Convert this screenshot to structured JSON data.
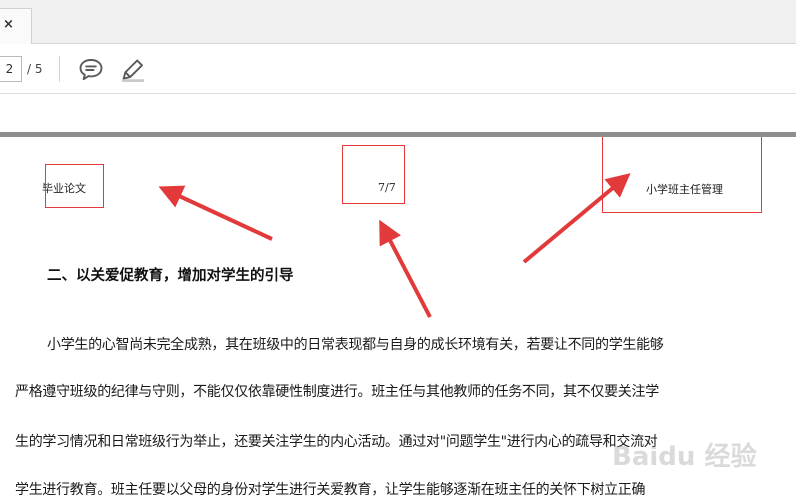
{
  "tabbar": {
    "close_glyph": "×"
  },
  "toolbar": {
    "page_value": "2",
    "page_total": "/ 5",
    "comment_icon": "speech-bubble",
    "pen_icon": "highlighter-pen"
  },
  "page": {
    "header_left": "毕业论文",
    "header_center": "7/7",
    "header_right": "小学班主任管理",
    "heading": "二、以关爱促教育，增加对学生的引导",
    "lines": [
      "小学生的心智尚未完全成熟，其在班级中的日常表现都与自身的成长环境有关，若要让不同的学生能够",
      "严格遵守班级的纪律与守则，不能仅仅依靠硬性制度进行。班主任与其他教师的任务不同，其不仅要关注学",
      "生的学习情况和日常班级行为举止，还要关注学生的内心活动。通过对\"问题学生\"进行内心的疏导和交流对",
      "学生进行教育。班主任要以父母的身份对学生进行关爱教育，让学生能够逐渐在班主任的关怀下树立正确"
    ]
  },
  "annotations": {
    "color": "#e23a3a"
  },
  "watermark": "Baidu 经验"
}
